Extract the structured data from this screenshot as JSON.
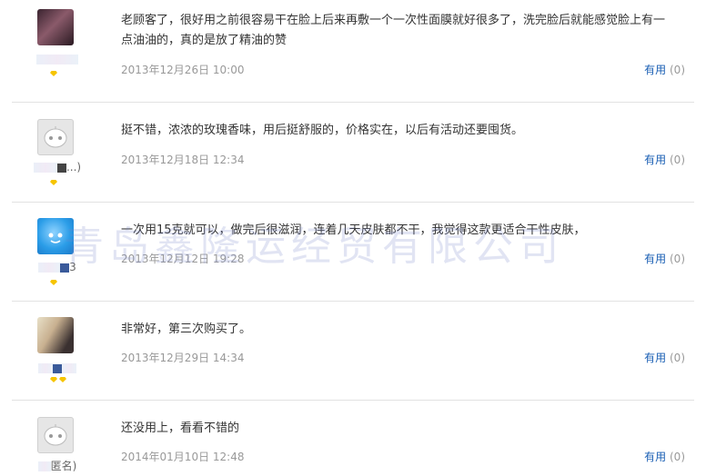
{
  "reviews": [
    {
      "content": "老顾客了，很好用之前很容易干在脸上后来再敷一个一次性面膜就好很多了，洗完脸后就能感觉脸上有一点油油的，真的是放了精油的赞",
      "date": "2013年12月26日 10:00",
      "useful_label": "有用",
      "useful_count": "(0)",
      "avatar": "photo-avatar-icon",
      "username": "",
      "rank_gems": 1
    },
    {
      "content": "挺不错，浓浓的玫瑰香味，用后挺舒服的，价格实在，以后有活动还要囤货。",
      "date": "2013年12月18日 12:34",
      "useful_label": "有用",
      "useful_count": "(0)",
      "avatar": "robot-avatar-icon",
      "username": "...)",
      "rank_gems": 1
    },
    {
      "content": "一次用15克就可以，做完后很滋润，连着几天皮肤都不干，我觉得这款更适合干性皮肤，",
      "date": "2013年12月12日 19:28",
      "useful_label": "有用",
      "useful_count": "(0)",
      "avatar": "blue-avatar-icon",
      "username": "3",
      "rank_gems": 1
    },
    {
      "content": "非常好，第三次购买了。",
      "date": "2013年12月29日 14:34",
      "useful_label": "有用",
      "useful_count": "(0)",
      "avatar": "photo-avatar-icon",
      "username": "",
      "rank_gems": 2
    },
    {
      "content": "还没用上，看看不错的",
      "date": "2014年01月10日 12:48",
      "useful_label": "有用",
      "useful_count": "(0)",
      "avatar": "robot-avatar-icon",
      "username": "匿名)",
      "rank_gems": 0
    }
  ],
  "watermark": "青岛鑫隆运经贸有限公司",
  "colors": {
    "link": "#1a5fb4",
    "meta": "#999999",
    "gem": "#f6c400"
  }
}
